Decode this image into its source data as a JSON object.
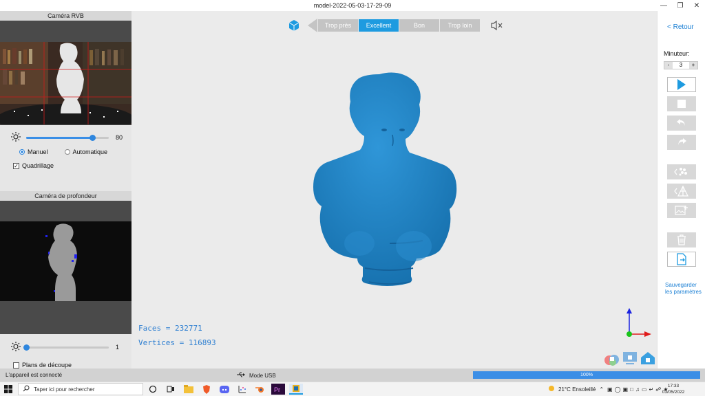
{
  "window": {
    "title": "model-2022-05-03-17-29-09"
  },
  "left_panel": {
    "rgb_camera_title": "Caméra RVB",
    "brightness_value": "80",
    "brightness_fraction": 0.8,
    "mode_manual": "Manuel",
    "mode_auto": "Automatique",
    "grid_label": "Quadrillage",
    "depth_camera_title": "Caméra de profondeur",
    "depth_value": "1",
    "depth_fraction": 0.0,
    "clip_planes_label": "Plans de découpe"
  },
  "quality": {
    "too_close": "Trop près",
    "excellent": "Excellent",
    "good": "Bon",
    "too_far": "Trop loin"
  },
  "stats": {
    "faces": "Faces = 232771",
    "vertices": "Vertices = 116893"
  },
  "right_panel": {
    "back": "< Retour",
    "timer_label": "Minuteur:",
    "timer_minus": "-",
    "timer_value": "3",
    "timer_plus": "+",
    "save_params": "Sauvegarder les paramètres"
  },
  "status": {
    "device": "L'appareil est connecté",
    "usb_mode": "Mode USB",
    "progress_text": "100%",
    "progress": 1.0
  },
  "taskbar": {
    "search_placeholder": "Taper ici pour rechercher",
    "weather": "21°C  Ensoleillé",
    "time": "17:33",
    "date": "03/05/2022"
  },
  "colors": {
    "accent": "#1e9be0",
    "model": "#1f7fc0",
    "stats_text": "#2e7fd1"
  }
}
